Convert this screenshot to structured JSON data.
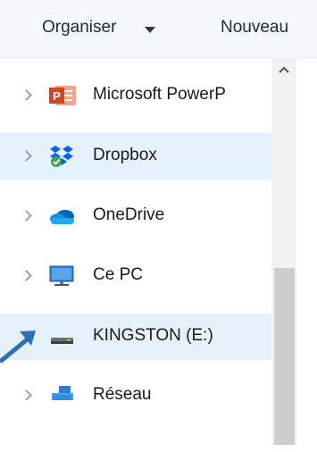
{
  "toolbar": {
    "organise_label": "Organiser",
    "new_label": "Nouveau"
  },
  "nav": {
    "items": [
      {
        "label": "Microsoft PowerP",
        "icon": "powerpoint-icon",
        "selected": false
      },
      {
        "label": "Dropbox",
        "icon": "dropbox-icon",
        "selected": true
      },
      {
        "label": "OneDrive",
        "icon": "onedrive-cloud-icon",
        "selected": false
      },
      {
        "label": "Ce PC",
        "icon": "computer-monitor-icon",
        "selected": false
      },
      {
        "label": "KINGSTON (E:)",
        "icon": "usb-drive-icon",
        "selected": true
      },
      {
        "label": "Réseau",
        "icon": "network-icon",
        "selected": false
      }
    ]
  },
  "colors": {
    "selection": "#e5f1fb",
    "toolbar_bg": "#f4f7fb",
    "pointer_arrow": "#2e6fb7"
  }
}
